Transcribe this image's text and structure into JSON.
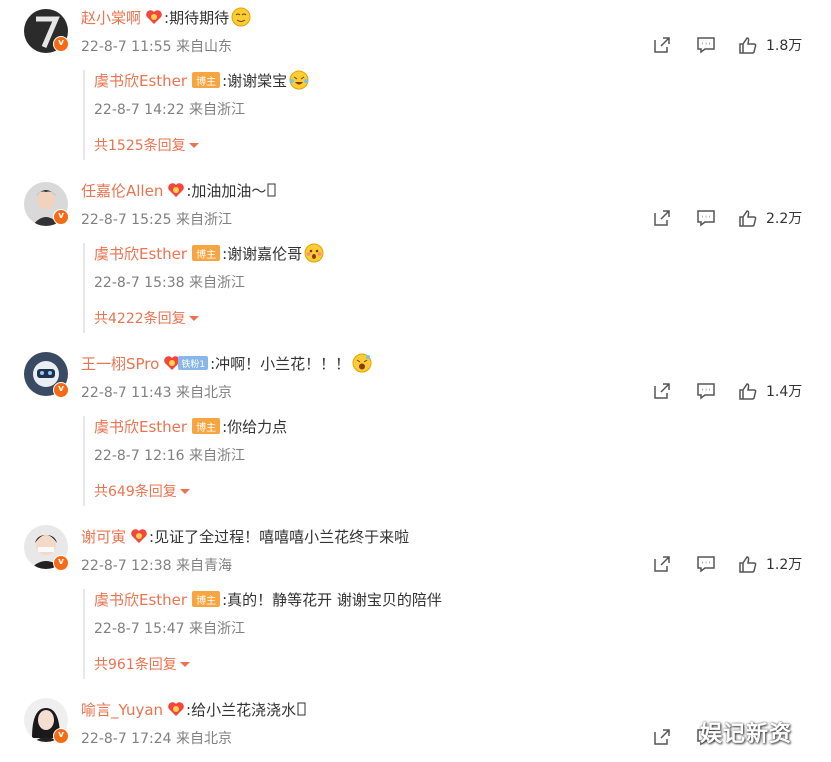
{
  "colors": {
    "username": "#eb7350",
    "host_badge": "#f7a541",
    "meta": "#808080",
    "fan_badge": "#8ab6e9"
  },
  "comments": [
    {
      "username": "赵小棠啊",
      "text": ":期待期待",
      "emoji": "smirk-emoji",
      "time": "22-8-7 11:55 来自山东",
      "likes": "1.8万",
      "reply": {
        "username": "虞书欣Esther",
        "badge": "博主",
        "text": ":谢谢棠宝",
        "emoji": "happy-tears-emoji",
        "time": "22-8-7 14:22 来自浙江",
        "more": "共1525条回复"
      }
    },
    {
      "username": "任嘉伦Allen",
      "text": ":加油加油～",
      "emoji": "missing-glyph",
      "time": "22-8-7 15:25 来自浙江",
      "likes": "2.2万",
      "reply": {
        "username": "虞书欣Esther",
        "badge": "博主",
        "text": ":谢谢嘉伦哥",
        "emoji": "shy-emoji",
        "time": "22-8-7 15:38 来自浙江",
        "more": "共4222条回复"
      }
    },
    {
      "username": "王一栩SPro",
      "fan_badge": "铁粉1",
      "text": ":冲啊！小兰花！！！",
      "emoji": "excited-emoji",
      "time": "22-8-7 11:43 来自北京",
      "likes": "1.4万",
      "reply": {
        "username": "虞书欣Esther",
        "badge": "博主",
        "text": ":你给力点",
        "time": "22-8-7 12:16 来自浙江",
        "more": "共649条回复"
      }
    },
    {
      "username": "谢可寅",
      "text": ":见证了全过程！嘻嘻嘻小兰花终于来啦",
      "time": "22-8-7 12:38 来自青海",
      "likes": "1.2万",
      "reply": {
        "username": "虞书欣Esther",
        "badge": "博主",
        "text": ":真的！静等花开 谢谢宝贝的陪伴",
        "time": "22-8-7 15:47 来自浙江",
        "more": "共961条回复"
      }
    },
    {
      "username": "喻言_Yuyan",
      "text": ":给小兰花浇浇水",
      "emoji": "missing-glyph",
      "time": "22-8-7 17:24 来自北京",
      "likes": ""
    }
  ],
  "watermark": "娱记新资"
}
